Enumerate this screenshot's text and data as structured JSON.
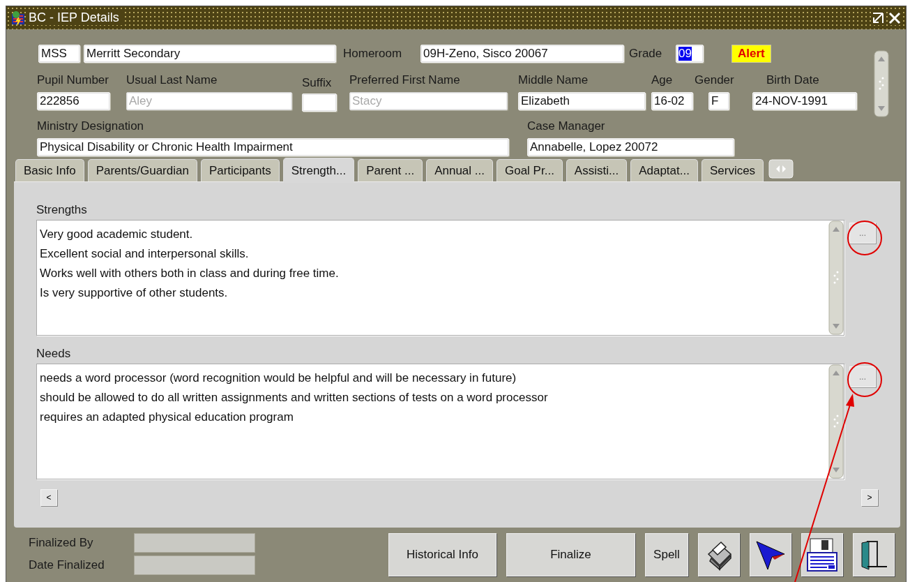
{
  "window": {
    "title": "BC - IEP Details"
  },
  "school": {
    "code": "MSS",
    "name": "Merritt Secondary",
    "homeroom_label": "Homeroom",
    "homeroom": "09H-Zeno, Sisco 20067",
    "grade_label": "Grade",
    "grade": "09",
    "grade_text_selected": true,
    "alert_button": "Alert"
  },
  "student_fields": [
    {
      "label": "Pupil Number",
      "value": "222856",
      "disabled": false
    },
    {
      "label": "Usual Last Name",
      "value": "Aley",
      "disabled": true
    },
    {
      "label": "Suffix",
      "disabled": false
    },
    {
      "label": "Preferred First Name",
      "value": "Stacy",
      "disabled": true
    },
    {
      "label": "Middle Name",
      "value": "Elizabeth",
      "disabled": false
    },
    {
      "label": "Age",
      "value": "16-02",
      "disabled": false
    },
    {
      "label": "Gender",
      "value": "F",
      "disabled": false
    },
    {
      "label": "Birth Date",
      "value": "24-NOV-1991",
      "disabled": false
    }
  ],
  "detail_fields": [
    {
      "label": "Ministry Designation",
      "value": "Physical Disability or Chronic Health Impairment"
    },
    {
      "label": "Case Manager",
      "value": "Annabelle, Lopez 20072"
    }
  ],
  "tabs": [
    {
      "label": "Basic Info",
      "selected": false
    },
    {
      "label": "Parents/Guardian",
      "selected": false
    },
    {
      "label": "Participants",
      "selected": false
    },
    {
      "label": "Strength...",
      "selected": true
    },
    {
      "label": "Parent ...",
      "selected": false
    },
    {
      "label": "Annual ...",
      "selected": false
    },
    {
      "label": "Goal Pr...",
      "selected": false
    },
    {
      "label": "Assisti...",
      "selected": false
    },
    {
      "label": "Adaptat...",
      "selected": false
    },
    {
      "label": "Services",
      "selected": false
    }
  ],
  "sections": [
    {
      "label": "Strengths",
      "more_button": "...",
      "lines": [
        "Very good academic student.",
        "Excellent social and interpersonal skills.",
        "Works well with others both in class and during free time.",
        "Is very supportive of other students."
      ]
    },
    {
      "label": "Needs",
      "more_button": "...",
      "lines": [
        "needs a word processor (word recognition would be helpful and will be necessary in future)",
        "should be allowed to do all written assignments and written sections of tests on a word processor",
        "requires an adapted physical education program"
      ]
    }
  ],
  "scroll_buttons": {
    "left": "<",
    "right": ">"
  },
  "finalize_fields": [
    {
      "label": "Finalized By"
    },
    {
      "label": "Date Finalized"
    }
  ],
  "buttons": [
    "Historical Info",
    "Finalize",
    "Spell"
  ],
  "icon_buttons": [
    {
      "kind": "printer"
    },
    {
      "kind": "cursor"
    },
    {
      "kind": "save"
    },
    {
      "kind": "exit"
    }
  ]
}
